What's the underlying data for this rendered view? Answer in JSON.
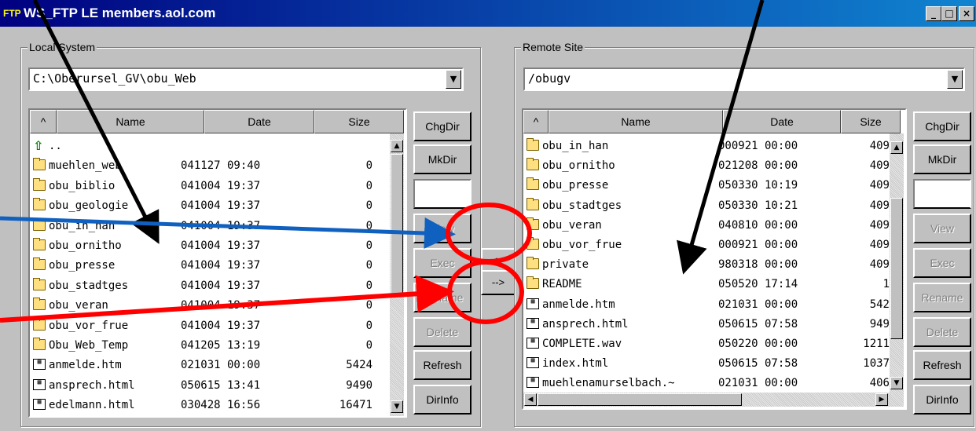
{
  "window": {
    "app_icon": "FTP",
    "title": "WS_FTP LE members.aol.com",
    "controls": [
      "_",
      "□",
      "×"
    ]
  },
  "local": {
    "group_label": "Local System",
    "path": "C:\\Oberursel_GV\\obu_Web",
    "columns": {
      "sort": "^",
      "name": "Name",
      "date": "Date",
      "size": "Size"
    },
    "rows": [
      {
        "icon": "up-arrow-icon",
        "name": "..",
        "date": "",
        "size": ""
      },
      {
        "icon": "folder-icon",
        "name": "muehlen_web",
        "date": "041127 09:40",
        "size": "0"
      },
      {
        "icon": "folder-icon",
        "name": "obu_biblio",
        "date": "041004 19:37",
        "size": "0"
      },
      {
        "icon": "folder-icon",
        "name": "obu_geologie",
        "date": "041004 19:37",
        "size": "0"
      },
      {
        "icon": "folder-icon",
        "name": "obu_in_han",
        "date": "041004 19:37",
        "size": "0"
      },
      {
        "icon": "folder-icon",
        "name": "obu_ornitho",
        "date": "041004 19:37",
        "size": "0"
      },
      {
        "icon": "folder-icon",
        "name": "obu_presse",
        "date": "041004 19:37",
        "size": "0"
      },
      {
        "icon": "folder-icon",
        "name": "obu_stadtges",
        "date": "041004 19:37",
        "size": "0"
      },
      {
        "icon": "folder-icon",
        "name": "obu_veran",
        "date": "041004 19:37",
        "size": "0"
      },
      {
        "icon": "folder-icon",
        "name": "obu_vor_frue",
        "date": "041004 19:37",
        "size": "0"
      },
      {
        "icon": "folder-icon",
        "name": "Obu_Web_Temp",
        "date": "041205 13:19",
        "size": "0"
      },
      {
        "icon": "file-icon",
        "name": "anmelde.htm",
        "date": "021031 00:00",
        "size": "5424"
      },
      {
        "icon": "file-icon",
        "name": "ansprech.html",
        "date": "050615 13:41",
        "size": "9490"
      },
      {
        "icon": "file-icon",
        "name": "edelmann.html",
        "date": "030428 16:56",
        "size": "16471"
      }
    ],
    "buttons": {
      "chgdir": "ChgDir",
      "mkdir": "MkDir",
      "view": "View",
      "exec": "Exec",
      "rename": "Rename",
      "delete": "Delete",
      "refresh": "Refresh",
      "dirinfo": "DirInfo"
    }
  },
  "transfer": {
    "to_local": "<--",
    "to_remote": "-->"
  },
  "remote": {
    "group_label": "Remote Site",
    "path": "/obugv",
    "columns": {
      "sort": "^",
      "name": "Name",
      "date": "Date",
      "size": "Size"
    },
    "rows": [
      {
        "icon": "folder-icon",
        "name": "obu_in_han",
        "date": "000921 00:00",
        "size": "409"
      },
      {
        "icon": "folder-icon",
        "name": "obu_ornitho",
        "date": "021208 00:00",
        "size": "409"
      },
      {
        "icon": "folder-icon",
        "name": "obu_presse",
        "date": "050330 10:19",
        "size": "409"
      },
      {
        "icon": "folder-icon",
        "name": "obu_stadtges",
        "date": "050330 10:21",
        "size": "409"
      },
      {
        "icon": "folder-icon",
        "name": "obu_veran",
        "date": "040810 00:00",
        "size": "409"
      },
      {
        "icon": "folder-icon",
        "name": "obu_vor_frue",
        "date": "000921 00:00",
        "size": "409"
      },
      {
        "icon": "folder-icon",
        "name": "private",
        "date": "980318 00:00",
        "size": "409"
      },
      {
        "icon": "folder-icon",
        "name": "README",
        "date": "050520 17:14",
        "size": "1"
      },
      {
        "icon": "file-icon",
        "name": "anmelde.htm",
        "date": "021031 00:00",
        "size": "542"
      },
      {
        "icon": "file-icon",
        "name": "ansprech.html",
        "date": "050615 07:58",
        "size": "949"
      },
      {
        "icon": "file-icon",
        "name": "COMPLETE.wav",
        "date": "050220 00:00",
        "size": "1211"
      },
      {
        "icon": "file-icon",
        "name": "index.html",
        "date": "050615 07:58",
        "size": "1037"
      },
      {
        "icon": "file-icon",
        "name": "muehlenamurselbach.~",
        "date": "021031 00:00",
        "size": "406"
      }
    ],
    "buttons": {
      "chgdir": "ChgDir",
      "mkdir": "MkDir",
      "view": "View",
      "exec": "Exec",
      "rename": "Rename",
      "delete": "Delete",
      "refresh": "Refresh",
      "dirinfo": "DirInfo"
    }
  },
  "annotations": {
    "arrow_colors": {
      "black": "#000000",
      "blue": "#1060c0",
      "red": "#ff0000"
    },
    "circle_color": "#ff0000"
  }
}
